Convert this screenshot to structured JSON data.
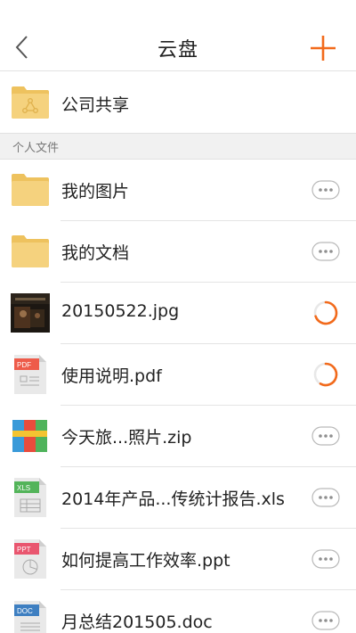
{
  "nav": {
    "title": "云盘"
  },
  "shared": {
    "label": "公司共享"
  },
  "section": {
    "title": "个人文件"
  },
  "files": [
    {
      "label": "我的图片"
    },
    {
      "label": "我的文档"
    },
    {
      "label": "20150522.jpg"
    },
    {
      "label": "使用说明.pdf"
    },
    {
      "label": "今天旅...照片.zip"
    },
    {
      "label": "2014年产品...传统计报告.xls"
    },
    {
      "label": "如何提高工作效率.ppt"
    },
    {
      "label": "月总结201505.doc"
    }
  ],
  "file_type_labels": {
    "pdf": "PDF",
    "xls": "XLS",
    "ppt": "PPT",
    "doc": "DOC"
  },
  "colors": {
    "accent": "#f26a1b",
    "folder": "#f5d27e",
    "pdf": "#ee5b4a",
    "xls": "#53b45a",
    "ppt": "#e9566f",
    "doc": "#3e7fc1"
  }
}
